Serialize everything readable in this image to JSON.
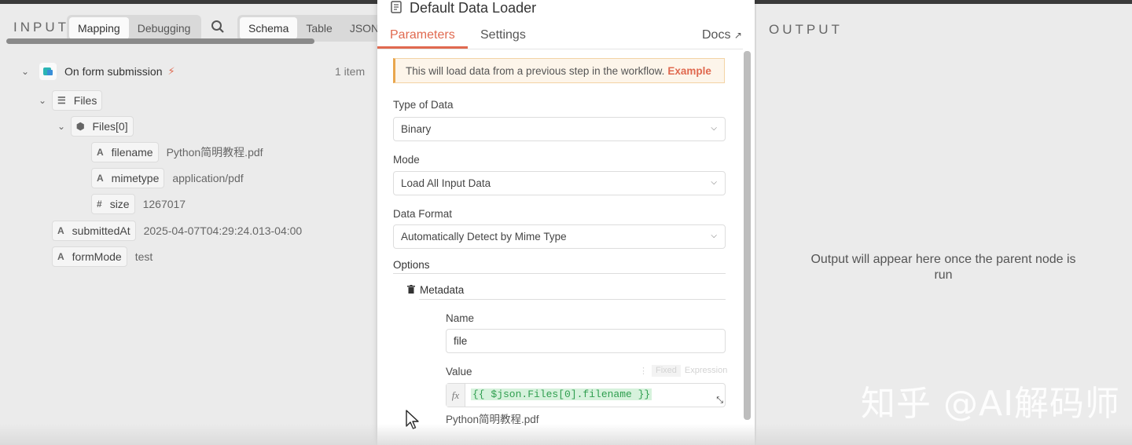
{
  "input": {
    "title": "INPUT",
    "mode_tabs": [
      "Mapping",
      "Debugging"
    ],
    "view_tabs": [
      "Schema",
      "Table",
      "JSON"
    ],
    "source_node": "On form submission",
    "item_count": "1 item",
    "tree": {
      "files": "Files",
      "files0": "Files[0]",
      "filename_key": "filename",
      "filename_val": "Python简明教程.pdf",
      "mimetype_key": "mimetype",
      "mimetype_val": "application/pdf",
      "size_key": "size",
      "size_val": "1267017",
      "submittedAt_key": "submittedAt",
      "submittedAt_val": "2025-04-07T04:29:24.013-04:00",
      "formMode_key": "formMode",
      "formMode_val": "test"
    }
  },
  "node": {
    "title": "Default Data Loader",
    "tabs": [
      "Parameters",
      "Settings"
    ],
    "docs": "Docs",
    "notice": "This will load data from a previous step in the workflow.",
    "notice_link": "Example",
    "type_label": "Type of Data",
    "type_value": "Binary",
    "mode_label": "Mode",
    "mode_value": "Load All Input Data",
    "format_label": "Data Format",
    "format_value": "Automatically Detect by Mime Type",
    "options_label": "Options",
    "metadata_label": "Metadata",
    "name_label": "Name",
    "name_value": "file",
    "value_label": "Value",
    "fixed": "Fixed",
    "expression": "Expression",
    "fx": "fx",
    "expression_value": "{{ $json.Files[0].filename }}",
    "expression_result": "Python简明教程.pdf"
  },
  "output": {
    "title": "OUTPUT",
    "message": "Output will appear here once the parent node is run"
  },
  "watermark": "知乎 @AI解码师",
  "colors": {
    "accent": "#e0694f",
    "notice_bg": "#fdf5ea",
    "code_green": "#2f9e4f"
  }
}
